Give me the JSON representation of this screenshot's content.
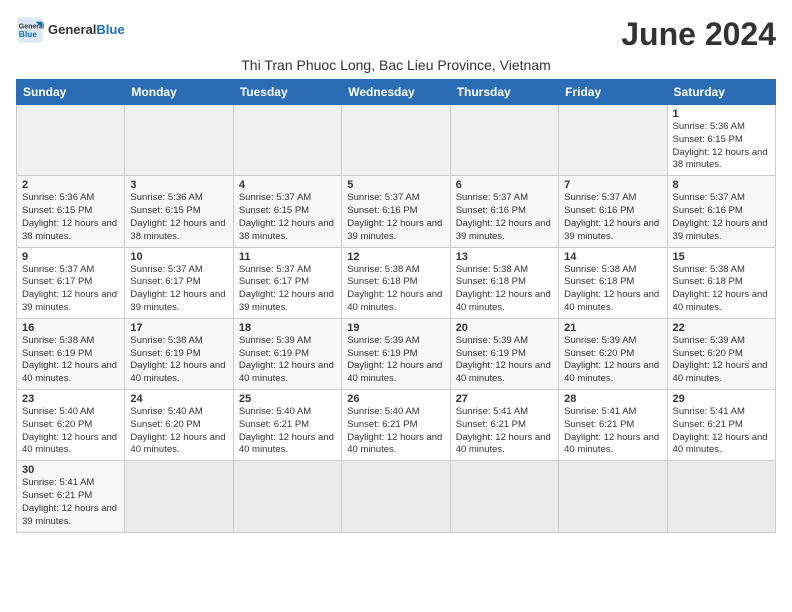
{
  "header": {
    "logo_general": "General",
    "logo_blue": "Blue",
    "month_title": "June 2024",
    "location": "Thi Tran Phuoc Long, Bac Lieu Province, Vietnam"
  },
  "weekdays": [
    "Sunday",
    "Monday",
    "Tuesday",
    "Wednesday",
    "Thursday",
    "Friday",
    "Saturday"
  ],
  "weeks": [
    [
      {
        "day": "",
        "info": ""
      },
      {
        "day": "",
        "info": ""
      },
      {
        "day": "",
        "info": ""
      },
      {
        "day": "",
        "info": ""
      },
      {
        "day": "",
        "info": ""
      },
      {
        "day": "",
        "info": ""
      },
      {
        "day": "1",
        "info": "Sunrise: 5:36 AM\nSunset: 6:15 PM\nDaylight: 12 hours and 38 minutes."
      }
    ],
    [
      {
        "day": "2",
        "info": "Sunrise: 5:36 AM\nSunset: 6:15 PM\nDaylight: 12 hours and 38 minutes."
      },
      {
        "day": "3",
        "info": "Sunrise: 5:36 AM\nSunset: 6:15 PM\nDaylight: 12 hours and 38 minutes."
      },
      {
        "day": "4",
        "info": "Sunrise: 5:37 AM\nSunset: 6:15 PM\nDaylight: 12 hours and 38 minutes."
      },
      {
        "day": "5",
        "info": "Sunrise: 5:37 AM\nSunset: 6:16 PM\nDaylight: 12 hours and 39 minutes."
      },
      {
        "day": "6",
        "info": "Sunrise: 5:37 AM\nSunset: 6:16 PM\nDaylight: 12 hours and 39 minutes."
      },
      {
        "day": "7",
        "info": "Sunrise: 5:37 AM\nSunset: 6:16 PM\nDaylight: 12 hours and 39 minutes."
      },
      {
        "day": "8",
        "info": "Sunrise: 5:37 AM\nSunset: 6:16 PM\nDaylight: 12 hours and 39 minutes."
      }
    ],
    [
      {
        "day": "9",
        "info": "Sunrise: 5:37 AM\nSunset: 6:17 PM\nDaylight: 12 hours and 39 minutes."
      },
      {
        "day": "10",
        "info": "Sunrise: 5:37 AM\nSunset: 6:17 PM\nDaylight: 12 hours and 39 minutes."
      },
      {
        "day": "11",
        "info": "Sunrise: 5:37 AM\nSunset: 6:17 PM\nDaylight: 12 hours and 39 minutes."
      },
      {
        "day": "12",
        "info": "Sunrise: 5:38 AM\nSunset: 6:18 PM\nDaylight: 12 hours and 40 minutes."
      },
      {
        "day": "13",
        "info": "Sunrise: 5:38 AM\nSunset: 6:18 PM\nDaylight: 12 hours and 40 minutes."
      },
      {
        "day": "14",
        "info": "Sunrise: 5:38 AM\nSunset: 6:18 PM\nDaylight: 12 hours and 40 minutes."
      },
      {
        "day": "15",
        "info": "Sunrise: 5:38 AM\nSunset: 6:18 PM\nDaylight: 12 hours and 40 minutes."
      }
    ],
    [
      {
        "day": "16",
        "info": "Sunrise: 5:38 AM\nSunset: 6:19 PM\nDaylight: 12 hours and 40 minutes."
      },
      {
        "day": "17",
        "info": "Sunrise: 5:38 AM\nSunset: 6:19 PM\nDaylight: 12 hours and 40 minutes."
      },
      {
        "day": "18",
        "info": "Sunrise: 5:39 AM\nSunset: 6:19 PM\nDaylight: 12 hours and 40 minutes."
      },
      {
        "day": "19",
        "info": "Sunrise: 5:39 AM\nSunset: 6:19 PM\nDaylight: 12 hours and 40 minutes."
      },
      {
        "day": "20",
        "info": "Sunrise: 5:39 AM\nSunset: 6:19 PM\nDaylight: 12 hours and 40 minutes."
      },
      {
        "day": "21",
        "info": "Sunrise: 5:39 AM\nSunset: 6:20 PM\nDaylight: 12 hours and 40 minutes."
      },
      {
        "day": "22",
        "info": "Sunrise: 5:39 AM\nSunset: 6:20 PM\nDaylight: 12 hours and 40 minutes."
      }
    ],
    [
      {
        "day": "23",
        "info": "Sunrise: 5:40 AM\nSunset: 6:20 PM\nDaylight: 12 hours and 40 minutes."
      },
      {
        "day": "24",
        "info": "Sunrise: 5:40 AM\nSunset: 6:20 PM\nDaylight: 12 hours and 40 minutes."
      },
      {
        "day": "25",
        "info": "Sunrise: 5:40 AM\nSunset: 6:21 PM\nDaylight: 12 hours and 40 minutes."
      },
      {
        "day": "26",
        "info": "Sunrise: 5:40 AM\nSunset: 6:21 PM\nDaylight: 12 hours and 40 minutes."
      },
      {
        "day": "27",
        "info": "Sunrise: 5:41 AM\nSunset: 6:21 PM\nDaylight: 12 hours and 40 minutes."
      },
      {
        "day": "28",
        "info": "Sunrise: 5:41 AM\nSunset: 6:21 PM\nDaylight: 12 hours and 40 minutes."
      },
      {
        "day": "29",
        "info": "Sunrise: 5:41 AM\nSunset: 6:21 PM\nDaylight: 12 hours and 40 minutes."
      }
    ],
    [
      {
        "day": "30",
        "info": "Sunrise: 5:41 AM\nSunset: 6:21 PM\nDaylight: 12 hours and 39 minutes."
      },
      {
        "day": "",
        "info": ""
      },
      {
        "day": "",
        "info": ""
      },
      {
        "day": "",
        "info": ""
      },
      {
        "day": "",
        "info": ""
      },
      {
        "day": "",
        "info": ""
      },
      {
        "day": "",
        "info": ""
      }
    ]
  ]
}
